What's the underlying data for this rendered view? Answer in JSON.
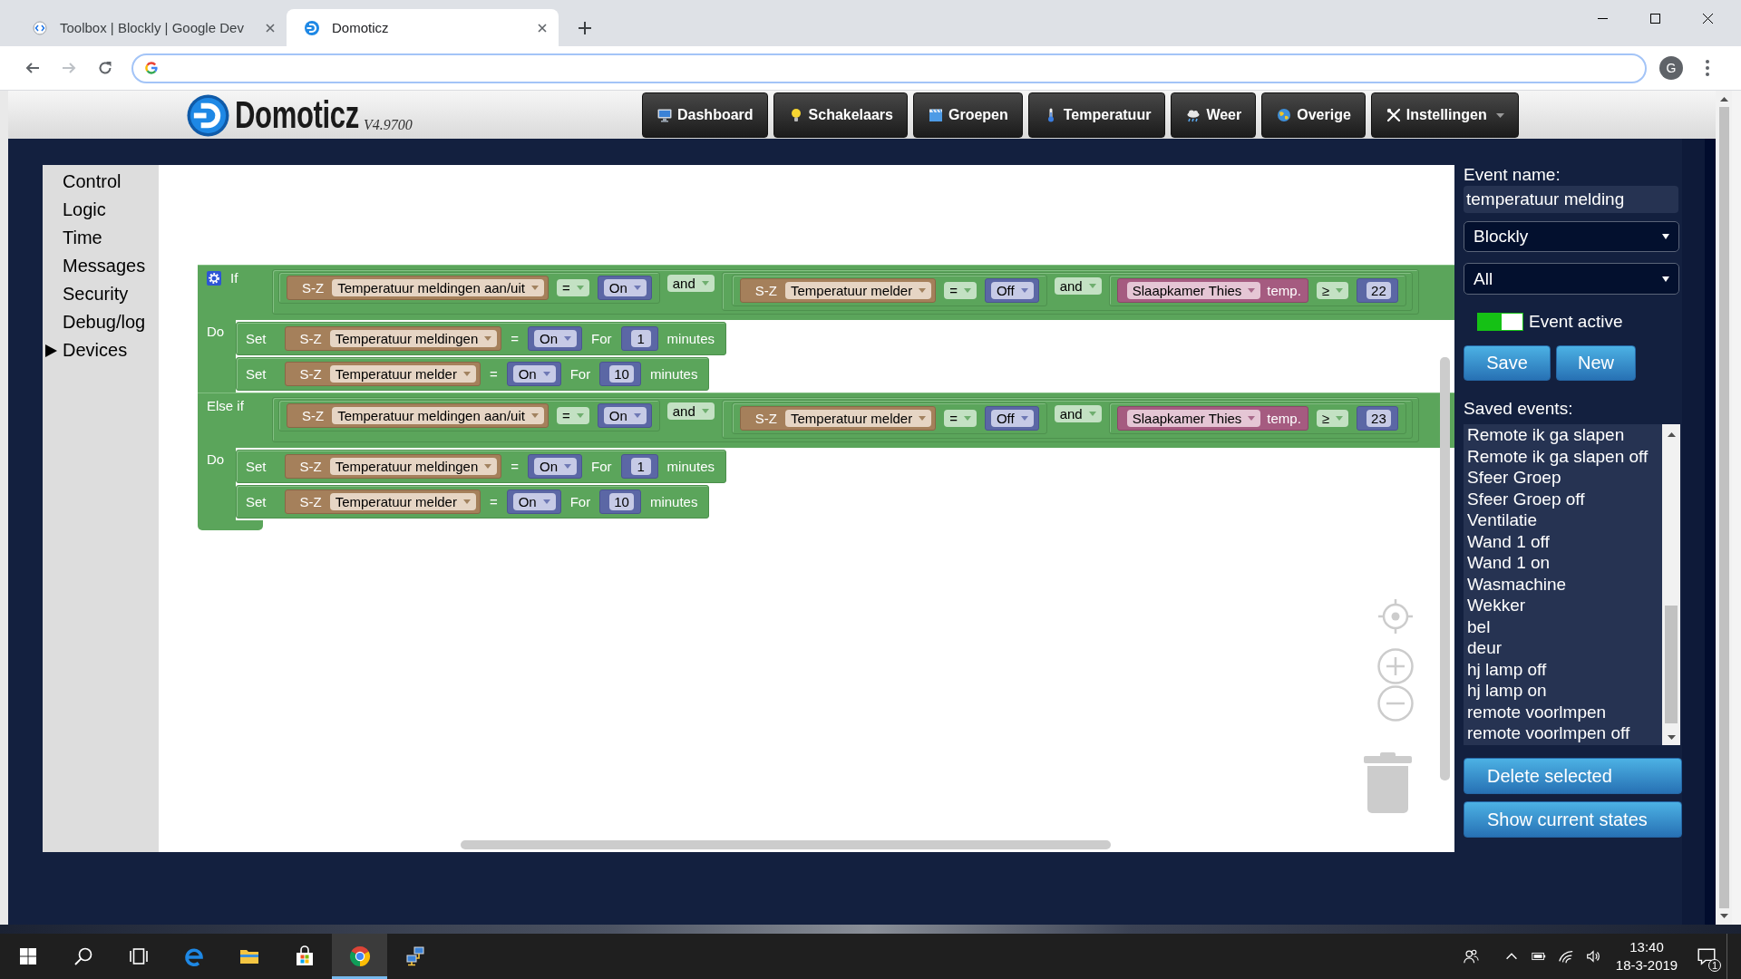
{
  "browser": {
    "tabs": [
      {
        "title": "Toolbox | Blockly | Google Dev",
        "selected": false
      },
      {
        "title": "Domoticz",
        "selected": true
      }
    ],
    "profile_initial": "G"
  },
  "header": {
    "logo": "Domoticz",
    "version": "V4.9700",
    "nav": [
      {
        "label": "Dashboard",
        "dropdown": false
      },
      {
        "label": "Schakelaars",
        "dropdown": false
      },
      {
        "label": "Groepen",
        "dropdown": false
      },
      {
        "label": "Temperatuur",
        "dropdown": false
      },
      {
        "label": "Weer",
        "dropdown": false
      },
      {
        "label": "Overige",
        "dropdown": false
      },
      {
        "label": "Instellingen",
        "dropdown": true
      }
    ]
  },
  "toolbox": [
    {
      "label": "Control",
      "expandable": false
    },
    {
      "label": "Logic",
      "expandable": false
    },
    {
      "label": "Time",
      "expandable": false
    },
    {
      "label": "Messages",
      "expandable": false
    },
    {
      "label": "Security",
      "expandable": false
    },
    {
      "label": "Debug/log",
      "expandable": false
    },
    {
      "label": "Devices",
      "expandable": true
    }
  ],
  "program": {
    "branches": [
      {
        "label": "If",
        "condition": {
          "kind": "logic",
          "op": "and",
          "left": {
            "kind": "device_compare",
            "prefix": "S-Z",
            "device": "Temperatuur meldingen aan/uit",
            "operator": "=",
            "value": "On"
          },
          "right": {
            "kind": "logic",
            "op": "and",
            "left": {
              "kind": "device_compare",
              "prefix": "S-Z",
              "device": "Temperatuur melder",
              "operator": "=",
              "value": "Off"
            },
            "right": {
              "kind": "temp_compare",
              "device": "Slaapkamer Thies",
              "property": "temp.",
              "operator": "≥",
              "value": "22"
            }
          }
        },
        "do_label": "Do",
        "actions": [
          {
            "kind": "set",
            "label": "Set",
            "prefix": "S-Z",
            "device": "Temperatuur meldingen",
            "operator": "=",
            "value": "On",
            "for_label": "For",
            "duration": "1",
            "unit": "minutes"
          },
          {
            "kind": "set",
            "label": "Set",
            "prefix": "S-Z",
            "device": "Temperatuur melder",
            "operator": "=",
            "value": "On",
            "for_label": "For",
            "duration": "10",
            "unit": "minutes"
          }
        ]
      },
      {
        "label": "Else if",
        "condition": {
          "kind": "logic",
          "op": "and",
          "left": {
            "kind": "device_compare",
            "prefix": "S-Z",
            "device": "Temperatuur meldingen aan/uit",
            "operator": "=",
            "value": "On"
          },
          "right": {
            "kind": "logic",
            "op": "and",
            "left": {
              "kind": "device_compare",
              "prefix": "S-Z",
              "device": "Temperatuur melder",
              "operator": "=",
              "value": "Off"
            },
            "right": {
              "kind": "temp_compare",
              "device": "Slaapkamer Thies",
              "property": "temp.",
              "operator": "≥",
              "value": "23"
            }
          }
        },
        "do_label": "Do",
        "actions": [
          {
            "kind": "set",
            "label": "Set",
            "prefix": "S-Z",
            "device": "Temperatuur meldingen",
            "operator": "=",
            "value": "On",
            "for_label": "For",
            "duration": "1",
            "unit": "minutes"
          },
          {
            "kind": "set",
            "label": "Set",
            "prefix": "S-Z",
            "device": "Temperatuur melder",
            "operator": "=",
            "value": "On",
            "for_label": "For",
            "duration": "10",
            "unit": "minutes"
          }
        ]
      }
    ]
  },
  "event_panel": {
    "name_label": "Event name:",
    "name": "temperatuur melding",
    "type": "Blockly",
    "filter": "All",
    "active": true,
    "active_label": "Event active",
    "save": "Save",
    "new": "New",
    "saved_label": "Saved events:",
    "saved_events": [
      {
        "name": "Remote ik ga slapen",
        "selected": false
      },
      {
        "name": "Remote ik ga slapen off",
        "selected": false
      },
      {
        "name": "Sfeer Groep",
        "selected": false
      },
      {
        "name": "Sfeer Groep off",
        "selected": false
      },
      {
        "name": "Ventilatie",
        "selected": false
      },
      {
        "name": "Wand 1 off",
        "selected": false
      },
      {
        "name": "Wand 1 on",
        "selected": false
      },
      {
        "name": "Wasmachine",
        "selected": false
      },
      {
        "name": "Wekker",
        "selected": false
      },
      {
        "name": "bel",
        "selected": false
      },
      {
        "name": "deur",
        "selected": false
      },
      {
        "name": "hj lamp off",
        "selected": false
      },
      {
        "name": "hj lamp on",
        "selected": false
      },
      {
        "name": "remote voorlmpen",
        "selected": false
      },
      {
        "name": "remote voorlmpen off",
        "selected": false
      }
    ],
    "delete": "Delete selected",
    "show_states": "Show current states"
  },
  "taskbar": {
    "apps": [
      {
        "active": false
      },
      {
        "active": false
      },
      {
        "active": false
      },
      {
        "active": true
      },
      {
        "active": false
      }
    ],
    "time": "13:40",
    "date": "18-3-2019",
    "notifications": "1"
  }
}
